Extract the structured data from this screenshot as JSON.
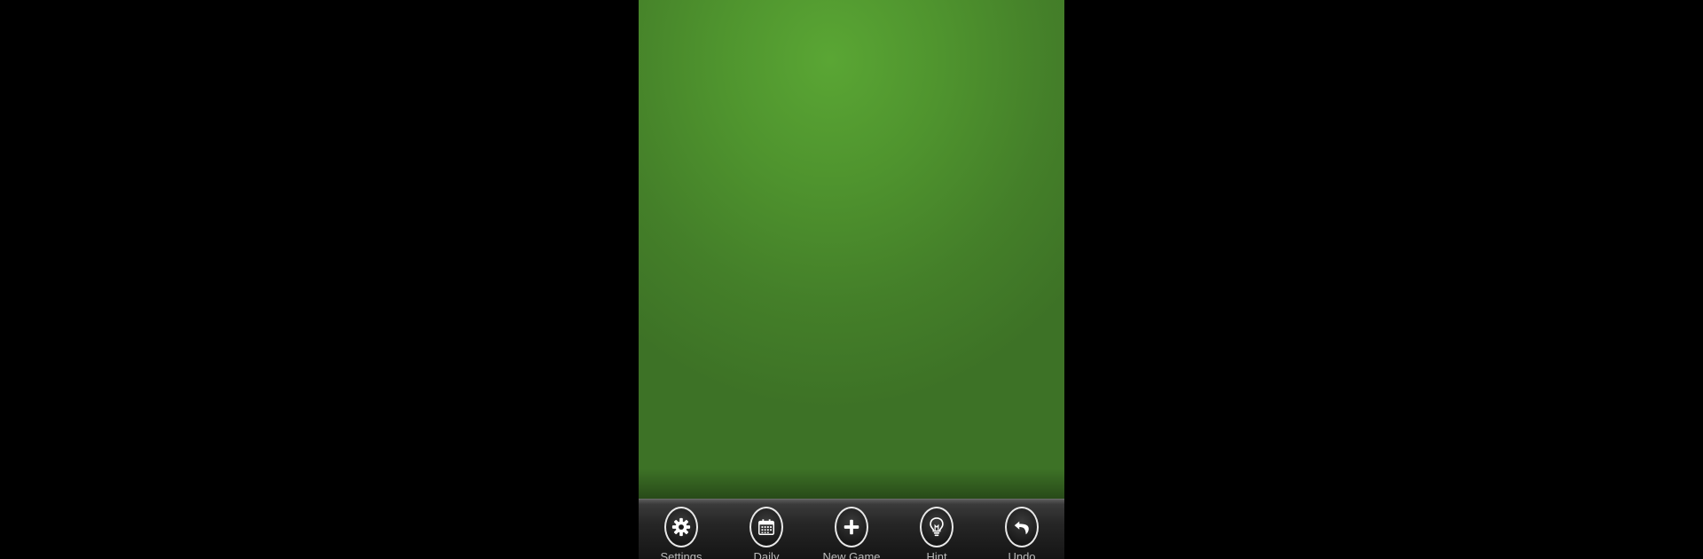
{
  "toolbar": {
    "buttons": [
      {
        "label": "Settings",
        "icon": "gear-icon"
      },
      {
        "label": "Daily",
        "icon": "calendar-icon"
      },
      {
        "label": "New Game",
        "icon": "plus-icon"
      },
      {
        "label": "Hint",
        "icon": "lightbulb-icon"
      },
      {
        "label": "Undo",
        "icon": "undo-arrow-icon"
      }
    ]
  },
  "colors": {
    "felt": "#54a030",
    "toolbar": "#262626",
    "icon": "#ffffff",
    "label": "#bdbdbd"
  }
}
